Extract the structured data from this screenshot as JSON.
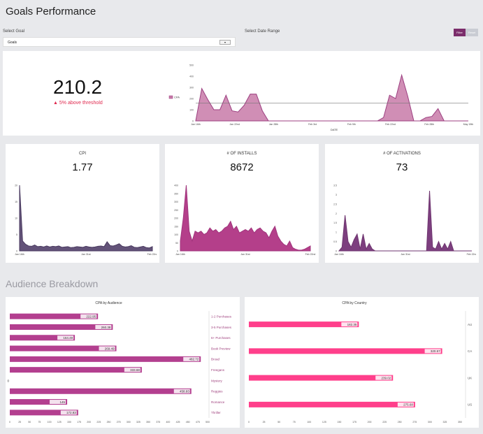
{
  "page": {
    "title": "Goals Performance",
    "section_title": "Audience Breakdown"
  },
  "filters": {
    "goal_label": "Select Goal",
    "goal_value": "Goals",
    "date_label": "Select Date Range",
    "filter_label": "Filter",
    "reset_label": "Reset"
  },
  "summary": {
    "value": "210.2",
    "change_text": "5% above threshold",
    "legend_label": "CPA",
    "xlabel": "DATE"
  },
  "kpis": [
    {
      "title": "CPI",
      "value": "1.77"
    },
    {
      "title": "# OF INSTALLS",
      "value": "8672"
    },
    {
      "title": "# OF ACTIVATIONS",
      "value": "73"
    }
  ],
  "colors": {
    "accent": "#a0437f",
    "area_mauve": "#c87aa8",
    "pink": "#ff3f8b",
    "dark_area": "#5b3d6e",
    "threshold_line": "#888888",
    "alert": "#e02a4f"
  },
  "chart_data": [
    {
      "type": "area",
      "id": "cpa-over-time",
      "xlabel": "DATE",
      "ylim": [
        0,
        500
      ],
      "yticks": [
        "0",
        "100",
        "200",
        "300",
        "400",
        "500"
      ],
      "xticks": [
        "Jan 16th",
        "Jan 22nd",
        "Jan 28th",
        "Feb 3rd",
        "Feb 9th",
        "Feb 22nd",
        "Feb 28th",
        "May 15th"
      ],
      "threshold": 160,
      "series": [
        {
          "name": "CPA",
          "values": [
            0,
            290,
            190,
            100,
            100,
            230,
            90,
            80,
            140,
            240,
            240,
            90,
            0,
            0,
            0,
            0,
            0,
            0,
            0,
            0,
            0,
            0,
            0,
            0,
            0,
            0,
            0,
            0,
            0,
            0,
            0,
            30,
            230,
            200,
            410,
            220,
            0,
            0,
            30,
            40,
            110,
            0,
            0,
            0,
            0,
            0
          ]
        }
      ]
    },
    {
      "type": "area",
      "id": "cpi-over-time",
      "ylim": [
        0,
        20
      ],
      "yticks": [
        "0",
        "5",
        "10",
        "15",
        "20"
      ],
      "xticks": [
        "Jan 16th",
        "Jan 31st",
        "Feb 22nd"
      ],
      "series": [
        {
          "name": "",
          "values": [
            20,
            3,
            2,
            1.5,
            1.4,
            1.8,
            1.3,
            1.4,
            1.2,
            1.5,
            1.2,
            1.4,
            1.3,
            1.5,
            1.1,
            1.2,
            1.3,
            1,
            1.1,
            1.3,
            1.2,
            1.1,
            1.4,
            1.2,
            1.1,
            1.2,
            1.4,
            1.5,
            1.3,
            2.8,
            1.6,
            1.5,
            1.8,
            2.2,
            1.4,
            1.2,
            1.3,
            1.6,
            1.1,
            1,
            1.2,
            1.4,
            1,
            0.9,
            1.3
          ]
        }
      ]
    },
    {
      "type": "area",
      "id": "installs-over-time",
      "ylim": [
        0,
        400
      ],
      "yticks": [
        "0",
        "50",
        "100",
        "150",
        "200",
        "250",
        "300",
        "350",
        "400"
      ],
      "xticks": [
        "Jan 16th",
        "Jan 31st",
        "Feb 22nd"
      ],
      "series": [
        {
          "name": "",
          "values": [
            60,
            200,
            400,
            120,
            60,
            120,
            110,
            120,
            100,
            110,
            140,
            120,
            130,
            110,
            120,
            140,
            150,
            180,
            130,
            150,
            110,
            120,
            130,
            120,
            140,
            110,
            130,
            140,
            120,
            110,
            80,
            120,
            150,
            90,
            60,
            40,
            30,
            60,
            20,
            10,
            5,
            5,
            10,
            20,
            30
          ]
        }
      ]
    },
    {
      "type": "area",
      "id": "activations-over-time",
      "ylim": [
        0,
        3.5
      ],
      "yticks": [
        "0",
        "0.5",
        "1",
        "1.5",
        "2",
        "2.5",
        "3",
        "3.5"
      ],
      "xticks": [
        "Jan 16th",
        "Jan 31st",
        "Feb 22nd"
      ],
      "series": [
        {
          "name": "",
          "values": [
            0,
            0.2,
            1.9,
            0.5,
            0.2,
            0.6,
            0.9,
            0.1,
            0.9,
            0.1,
            0.4,
            0.1,
            0,
            0,
            0,
            0,
            0,
            0,
            0,
            0,
            0,
            0,
            0,
            0,
            0,
            0,
            0,
            0,
            0,
            0,
            3.2,
            0.2,
            0.1,
            0.5,
            0.1,
            0.4,
            0.1,
            0.5,
            0,
            0,
            0,
            0,
            0,
            0,
            0
          ]
        }
      ]
    },
    {
      "type": "bar",
      "id": "cpa-by-audience",
      "title": "CPA by Audience",
      "categories": [
        "1-2 Purchases",
        "3-5 Purchases",
        "6+ Purchases",
        "Book Preview",
        "Broad",
        "Freegans",
        "Mystery",
        "Reggies",
        "Romance",
        "Thriller"
      ],
      "values": [
        222.95,
        260.38,
        164.49,
        269.49,
        482.72,
        333.68,
        0,
        458.93,
        145,
        172.83
      ],
      "value_labels": [
        "222.95",
        "260.38",
        "164.49",
        "269.49",
        "482.72",
        "333.68",
        "0",
        "458.93",
        "145",
        "172.83"
      ],
      "xlim": [
        0,
        500
      ],
      "xticks": [
        "0",
        "25",
        "50",
        "75",
        "100",
        "125",
        "150",
        "175",
        "200",
        "225",
        "250",
        "275",
        "300",
        "325",
        "350",
        "375",
        "400",
        "425",
        "450",
        "475",
        "500"
      ]
    },
    {
      "type": "bar",
      "id": "cpa-by-country",
      "title": "CPA by Country",
      "categories": [
        "AU",
        "CA",
        "UK",
        "US"
      ],
      "values": [
        182.35,
        320.57,
        239.02,
        275.68
      ],
      "value_labels": [
        "182.35",
        "320.57",
        "239.02",
        "275.68"
      ],
      "xlim": [
        0,
        350
      ],
      "xticks": [
        "0",
        "25",
        "50",
        "75",
        "100",
        "125",
        "150",
        "175",
        "200",
        "225",
        "250",
        "275",
        "300",
        "325",
        "350"
      ]
    }
  ]
}
